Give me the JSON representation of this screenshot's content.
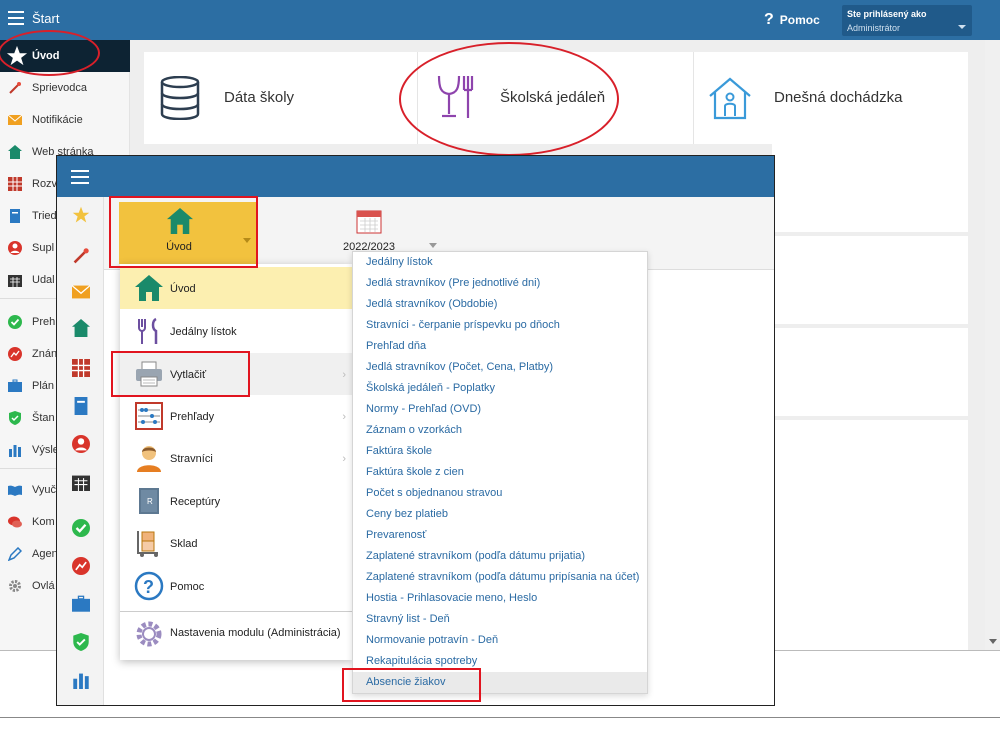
{
  "app": {
    "title": "Štart",
    "help_label": "Pomoc",
    "user_line1": "Ste prihlásený ako",
    "user_line2": "Administrátor"
  },
  "sidebar": {
    "items": [
      {
        "label": "Úvod",
        "icon": "star-icon"
      },
      {
        "label": "Sprievodca",
        "icon": "wand-icon"
      },
      {
        "label": "Notifikácie",
        "icon": "envelope-icon"
      },
      {
        "label": "Web stránka",
        "icon": "home-icon"
      },
      {
        "label": "Rozv",
        "icon": "grid-icon"
      },
      {
        "label": "Tried",
        "icon": "book-icon"
      },
      {
        "label": "Supl",
        "icon": "person-icon"
      },
      {
        "label": "Udal",
        "icon": "calendar-icon"
      },
      {
        "label": "Preh",
        "icon": "check-icon"
      },
      {
        "label": "Znán",
        "icon": "chart-circle-icon"
      },
      {
        "label": "Plán",
        "icon": "briefcase-icon"
      },
      {
        "label": "Štan",
        "icon": "shield-icon"
      },
      {
        "label": "Výsle",
        "icon": "bar-chart-icon"
      },
      {
        "label": "Vyuč",
        "icon": "open-book-icon"
      },
      {
        "label": "Kom",
        "icon": "chat-icon"
      },
      {
        "label": "Agen",
        "icon": "pen-icon"
      },
      {
        "label": "Ovlá",
        "icon": "gear-icon"
      }
    ]
  },
  "tiles": [
    {
      "label": "Dáta školy",
      "icon": "database-icon"
    },
    {
      "label": "Školská jedáleň",
      "icon": "cutlery-icon"
    },
    {
      "label": "Dnešná dochádzka",
      "icon": "house-person-icon"
    }
  ],
  "overlay": {
    "tabs": {
      "home_label": "Úvod",
      "year_label": "2022/2023"
    },
    "main_menu": [
      {
        "label": "Úvod",
        "icon": "home-icon"
      },
      {
        "label": "Jedálny lístok",
        "icon": "cutlery-icon"
      },
      {
        "label": "Vytlačiť",
        "icon": "printer-icon"
      },
      {
        "label": "Prehľady",
        "icon": "abacus-icon"
      },
      {
        "label": "Stravníci",
        "icon": "person-icon"
      },
      {
        "label": "Receptúry",
        "icon": "recipe-book-icon"
      },
      {
        "label": "Sklad",
        "icon": "trolley-icon"
      },
      {
        "label": "Pomoc",
        "icon": "question-icon"
      },
      {
        "label": "Nastavenia modulu (Administrácia)",
        "icon": "gear-icon"
      }
    ],
    "submenu": [
      "Jedálny lístok",
      "Jedlá stravníkov (Pre jednotlivé dni)",
      "Jedlá stravníkov (Obdobie)",
      "Stravníci - čerpanie príspevku po dňoch",
      "Prehľad dňa",
      "Jedlá stravníkov (Počet, Cena, Platby)",
      "Školská jedáleň - Poplatky",
      "Normy - Prehľad (OVD)",
      "Záznam o vzorkách",
      "Faktúra škole",
      "Faktúra škole z cien",
      "Počet s objednanou stravou",
      "Ceny bez platieb",
      "Prevarenosť",
      "Zaplatené stravníkom (podľa dátumu prijatia)",
      "Zaplatené stravníkom (podľa dátumu pripísania na účet)",
      "Hostia - Prihlasovacie meno, Heslo",
      "Stravný list - Deň",
      "Normovanie potravín - Deň",
      "Rekapitulácia spotreby",
      "Absencie žiakov"
    ]
  },
  "colors": {
    "topbar": "#2c6ea3",
    "active_sidebar": "#0d2333",
    "home_tab": "#f2c23e",
    "link": "#2a6aa3",
    "annotation_red": "#e1141f"
  }
}
